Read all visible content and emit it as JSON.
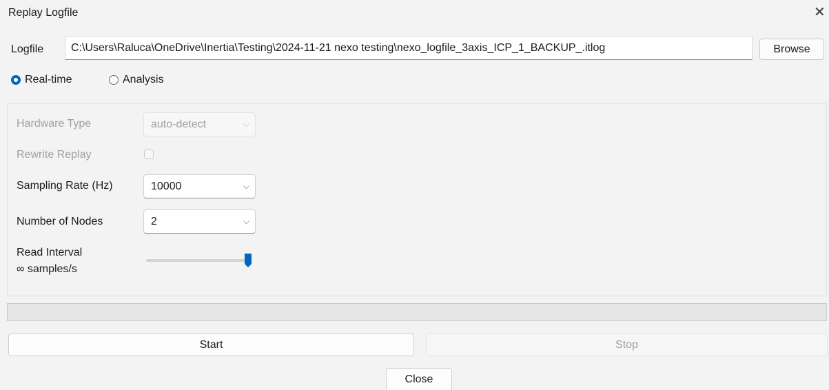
{
  "window": {
    "title": "Replay Logfile",
    "close_glyph": "✕"
  },
  "logfile": {
    "label": "Logfile",
    "path": "C:\\Users\\Raluca\\OneDrive\\Inertia\\Testing\\2024-11-21 nexo testing\\nexo_logfile_3axis_ICP_1_BACKUP_.itlog",
    "browse_label": "Browse"
  },
  "mode": {
    "options": [
      {
        "label": "Real-time",
        "selected": true
      },
      {
        "label": "Analysis",
        "selected": false
      }
    ]
  },
  "settings": {
    "hardware_type_label": "Hardware Type",
    "hardware_type_value": "auto-detect",
    "rewrite_replay_label": "Rewrite Replay",
    "rewrite_replay_checked": false,
    "sampling_rate_label": "Sampling Rate (Hz)",
    "sampling_rate_value": "10000",
    "nodes_label": "Number of Nodes",
    "nodes_value": "2",
    "read_interval_label": "Read Interval",
    "read_interval_value": "∞ samples/s",
    "read_interval_slider_fraction": 1.0
  },
  "progress": {
    "fraction": 0
  },
  "actions": {
    "start_label": "Start",
    "stop_label": "Stop",
    "close_label": "Close"
  },
  "colors": {
    "accent": "#0067c0",
    "background": "#f3f3f3"
  },
  "icons": {
    "dropdown": "chevron-down-icon",
    "close": "close-icon"
  }
}
